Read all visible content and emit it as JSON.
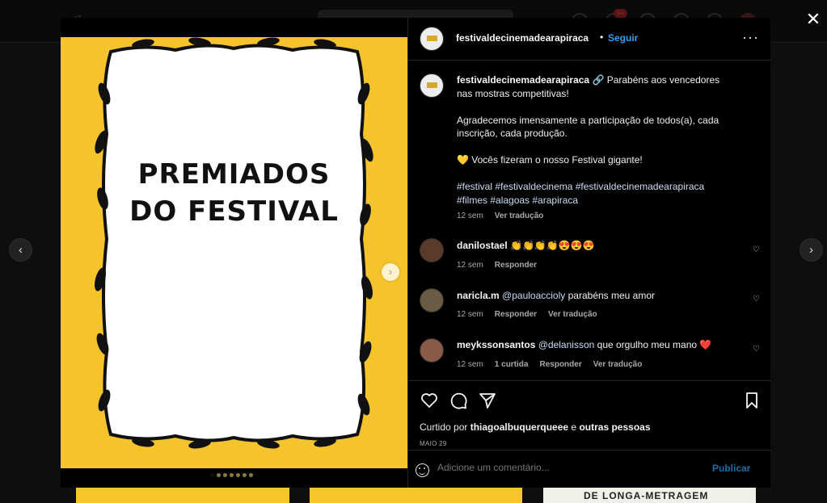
{
  "post": {
    "account": "festivaldecinemadearapiraca",
    "follow_label": "Seguir",
    "poster_line1": "PREMIADOS",
    "poster_line2": "DO FESTIVAL",
    "caption_first": "🔗 Parabéns aos vencedores",
    "caption_second": "nas mostras competitivas!",
    "caption_p2a": "Agradecemos imensamente a participação de todos(a), cada",
    "caption_p2b": "inscrição, cada produção.",
    "caption_p3": "💛 Vocês fizeram o nosso Festival gigante!",
    "hashtags_line1": "#festival #festivaldecinema #festivaldecinemadearapiraca",
    "hashtags_line2": "#filmes #alagoas #arapiraca",
    "caption_time": "12 sem",
    "translate_label": "Ver tradução",
    "liked_by_prefix": "Curtido por",
    "liked_by_user": "thiagoalbuquerqueee",
    "liked_by_and": "e",
    "liked_by_others": "outras pessoas",
    "date": "MAIO 29",
    "comment_placeholder": "Adicione um comentário...",
    "publish_label": "Publicar",
    "carousel_count": 7,
    "carousel_index": 0
  },
  "comments": [
    {
      "user": "danilostael",
      "mention": "",
      "text": "👏👏👏👏😍😍😍",
      "time": "12 sem",
      "likes": "",
      "reply": "Responder",
      "translate": ""
    },
    {
      "user": "naricla.m",
      "mention": "@pauloaccioly",
      "text": "parabéns meu amor",
      "time": "12 sem",
      "likes": "",
      "reply": "Responder",
      "translate": "Ver tradução"
    },
    {
      "user": "meykssonsantos",
      "mention": "@delanisson",
      "text": "que orgulho meu mano ❤️",
      "time": "12 sem",
      "likes": "1 curtida",
      "reply": "Responder",
      "translate": "Ver tradução"
    }
  ],
  "badge": "9+",
  "thumbs": {
    "right_label": "DE LONGA-METRAGEM"
  },
  "colors": {
    "accent": "#0095f6",
    "poster_bg": "#f5c42c"
  }
}
